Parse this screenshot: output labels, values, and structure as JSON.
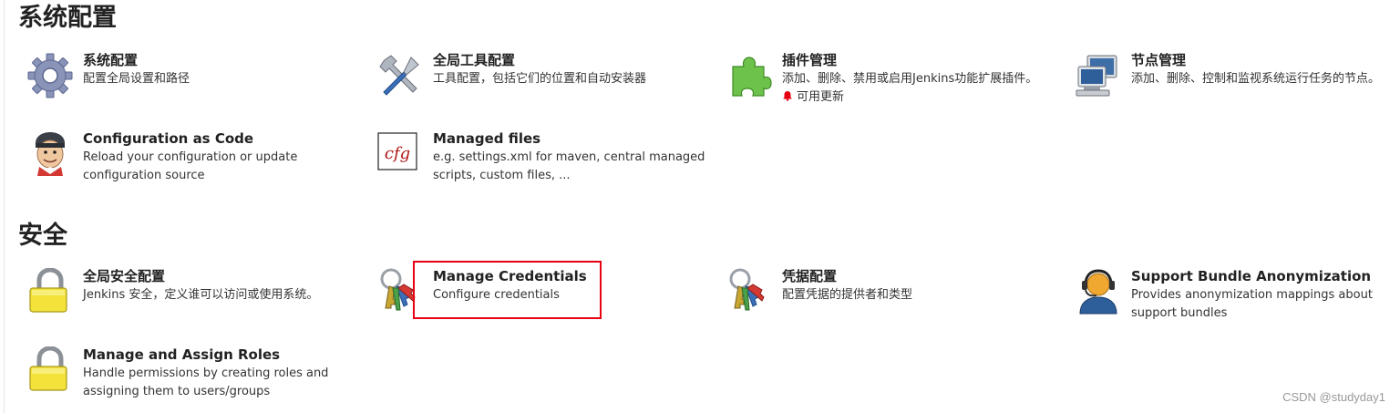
{
  "sections": {
    "system": {
      "title": "系统配置",
      "items": [
        {
          "title": "系统配置",
          "desc": "配置全局设置和路径",
          "icon": "gear-icon"
        },
        {
          "title": "全局工具配置",
          "desc": "工具配置，包括它们的位置和自动安装器",
          "icon": "tools-icon"
        },
        {
          "title": "插件管理",
          "desc": "添加、删除、禁用或启用Jenkins功能扩展插件。",
          "update": "可用更新",
          "icon": "puzzle-icon"
        },
        {
          "title": "节点管理",
          "desc": "添加、删除、控制和监视系统运行任务的节点。",
          "icon": "computer-icon"
        },
        {
          "title": "Configuration as Code",
          "desc": "Reload your configuration or update configuration source",
          "icon": "jenkins-butler-icon"
        },
        {
          "title": "Managed files",
          "desc": "e.g. settings.xml for maven, central managed scripts, custom files, ...",
          "icon": "cfg-file-icon"
        }
      ]
    },
    "security": {
      "title": "安全",
      "items": [
        {
          "title": "全局安全配置",
          "desc": "Jenkins 安全，定义谁可以访问或使用系统。",
          "icon": "lock-icon"
        },
        {
          "title": "Manage Credentials",
          "desc": "Configure credentials",
          "icon": "keys-icon"
        },
        {
          "title": "凭据配置",
          "desc": "配置凭据的提供者和类型",
          "icon": "keys-icon"
        },
        {
          "title": "Support Bundle Anonymization",
          "desc": "Provides anonymization mappings about support bundles",
          "icon": "support-agent-icon"
        },
        {
          "title": "Manage and Assign Roles",
          "desc": "Handle permissions by creating roles and assigning them to users/groups",
          "icon": "lock-icon"
        }
      ]
    }
  },
  "watermark": "CSDN @studyday1",
  "colors": {
    "highlight": "#e60012",
    "update_bell": "#e60012"
  }
}
